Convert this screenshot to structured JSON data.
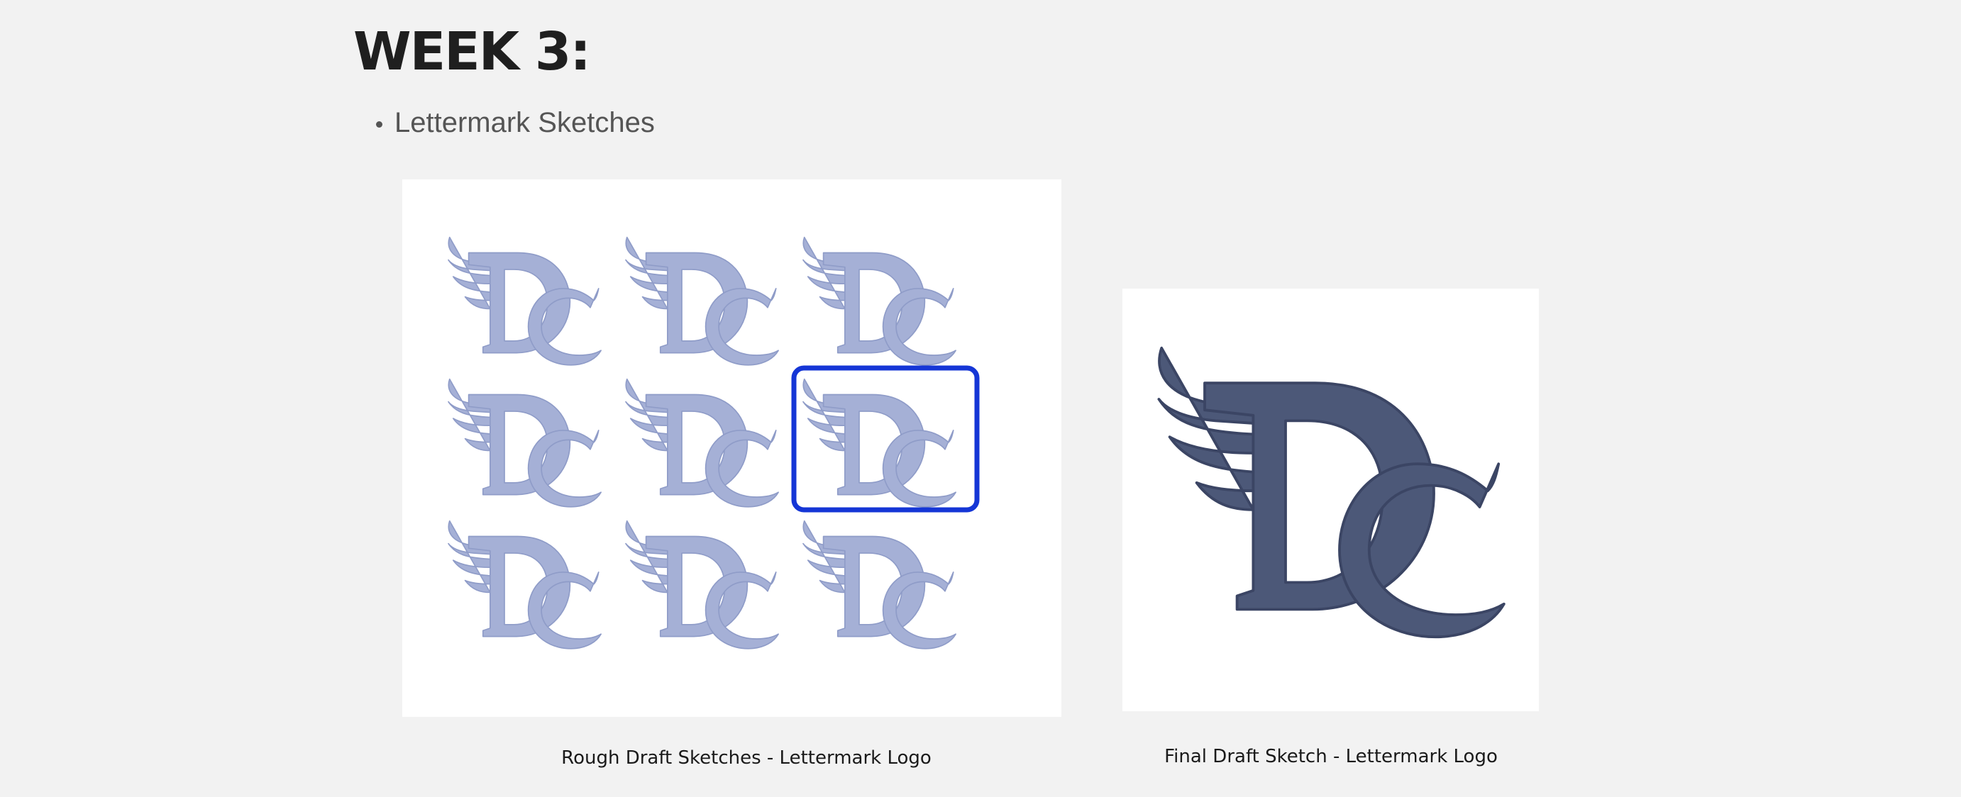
{
  "page": {
    "heading": "WEEK 3:",
    "bullets": [
      "Lettermark Sketches"
    ]
  },
  "gallery": {
    "rough_draft": {
      "caption": "Rough Draft Sketches - Lettermark Logo",
      "sketch_count": 9,
      "selected_index": 5,
      "sketch_color": "#a5b0d6",
      "highlight_color": "#1536d6"
    },
    "final_draft": {
      "caption": "Final Draft Sketch - Lettermark Logo",
      "sketch_color": "#4c5878"
    }
  }
}
